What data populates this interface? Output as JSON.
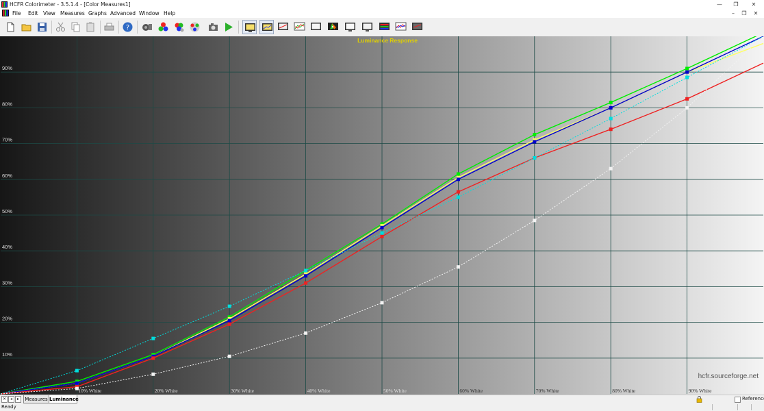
{
  "window": {
    "title": "HCFR Colorimeter - 3.5.1.4 - [Color Measures1]",
    "minimize": "—",
    "restore": "❐",
    "close": "✕"
  },
  "menu": {
    "items": [
      "File",
      "Edit",
      "View",
      "Measures",
      "Graphs",
      "Advanced",
      "Window",
      "Help"
    ],
    "doc_minimize": "–",
    "doc_restore": "❐",
    "doc_close": "✕"
  },
  "toolbar": {
    "buttons": [
      "new-document-icon",
      "open-folder-icon",
      "save-disk-icon",
      "cut-icon",
      "copy-icon",
      "paste-icon",
      "print-icon",
      "help-icon",
      "sensor-icon",
      "rgb-balls-icon",
      "measure-all-icon",
      "color-swatch-icon",
      "camera-icon",
      "play-icon",
      "display-view-icon",
      "display-view-2-icon",
      "display-view-3-icon",
      "graph-icon",
      "white-screen-icon",
      "cie-diagram-icon",
      "screen-icon",
      "screen-2-icon",
      "rgb-levels-icon",
      "histogram-icon",
      "screen-dark-icon"
    ],
    "pressed": [
      "display-view-icon",
      "display-view-2-icon"
    ],
    "colors": {
      "green": "#22aa22",
      "blue": "#1e5cb3",
      "yellow": "#e8b800",
      "red": "#d42020"
    }
  },
  "watermark": "hcfr.sourceforge.net",
  "chart_data": {
    "type": "line",
    "title": "Luminance Response",
    "title_color": "#e0d000",
    "x_categories": [
      "10% White",
      "20% White",
      "30% White",
      "40% White",
      "50% White",
      "60% White",
      "70% White",
      "80% White",
      "90% White"
    ],
    "x": [
      0,
      10,
      20,
      30,
      40,
      50,
      60,
      70,
      80,
      90,
      100
    ],
    "y_ticks": [
      "10%",
      "20%",
      "30%",
      "40%",
      "50%",
      "60%",
      "70%",
      "80%",
      "90%"
    ],
    "ylim": [
      0,
      100
    ],
    "xlim": [
      0,
      100
    ],
    "grid": true,
    "background": "gradient black to white",
    "series": [
      {
        "color": "#00ee00",
        "dash": false,
        "values": [
          0,
          3.5,
          11,
          21.5,
          34.5,
          47.5,
          61.5,
          72.5,
          81.5,
          91,
          101
        ]
      },
      {
        "color": "#ffff66",
        "dash": false,
        "values": [
          0,
          3,
          10.5,
          21,
          33.5,
          47,
          60.5,
          71,
          80,
          90,
          98
        ]
      },
      {
        "color": "#0000cc",
        "dash": false,
        "values": [
          0,
          3,
          10.5,
          20.5,
          33,
          46.5,
          60,
          70.5,
          80,
          90,
          100
        ]
      },
      {
        "color": "#ee2222",
        "dash": false,
        "values": [
          0,
          2,
          10,
          19.5,
          31,
          44,
          56.5,
          66,
          74,
          82.5,
          92.5
        ]
      },
      {
        "color": "#00dddd",
        "dash": true,
        "values": [
          0,
          6.5,
          15.5,
          24.5,
          34.5,
          45,
          55,
          66,
          77,
          88.5,
          100
        ]
      },
      {
        "color": "#f2f2f2",
        "dash": true,
        "values": [
          0,
          1.5,
          5.5,
          10.5,
          17,
          25.5,
          35.5,
          48.5,
          63,
          80,
          100
        ]
      }
    ]
  },
  "tabs": [
    {
      "label": "Measures",
      "active": false
    },
    {
      "label": "Luminance",
      "active": true
    }
  ],
  "reference": {
    "label": "Reference",
    "checked": false
  },
  "status": {
    "text": "Ready"
  }
}
